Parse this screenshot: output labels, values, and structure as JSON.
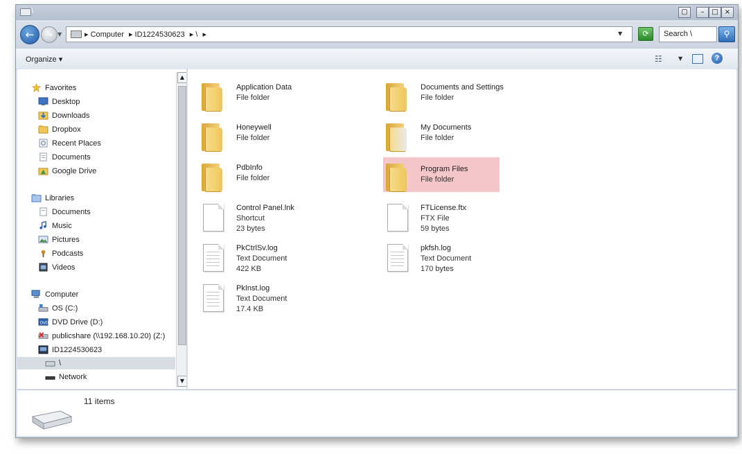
{
  "window": {
    "title": "\\"
  },
  "address": {
    "crumbs": [
      "▸ Computer",
      "▸ ID1224530623",
      "▸ \\",
      "▸"
    ],
    "search_placeholder": "Search \\"
  },
  "toolbar": {
    "organize_label": "Organize ▾"
  },
  "nav": {
    "favorites_header": "Favorites",
    "favorites": [
      "Desktop",
      "Downloads",
      "Dropbox",
      "Recent Places",
      "Documents",
      "Google Drive"
    ],
    "libraries_header": "Libraries",
    "libraries": [
      "Documents",
      "Music",
      "Pictures",
      "Podcasts",
      "Videos"
    ],
    "computer_header": "Computer",
    "computer": [
      "OS (C:)",
      "DVD Drive (D:)",
      "publicshare (\\\\192.168.10.20) (Z:)",
      "ID1224530623",
      "\\"
    ],
    "network_label": "Network"
  },
  "files": [
    {
      "name": "Application Data",
      "line1": "File folder",
      "line2": "",
      "icon": "folder-icon"
    },
    {
      "name": "Documents and Settings",
      "line1": "File folder",
      "line2": "",
      "icon": "folder-icon"
    },
    {
      "name": "Honeywell",
      "line1": "File folder",
      "line2": "",
      "icon": "folder-icon"
    },
    {
      "name": "My Documents",
      "line1": "File folder",
      "line2": "",
      "icon": "folder-icon"
    },
    {
      "name": "PdbInfo",
      "line1": "File folder",
      "line2": "",
      "icon": "folder-icon"
    },
    {
      "name": "Program Files",
      "line1": "File folder",
      "line2": "",
      "icon": "folder-icon",
      "highlighted": true
    },
    {
      "name": "Control Panel.lnk",
      "line1": "Shortcut",
      "line2": "23 bytes",
      "icon": "blank-file-icon"
    },
    {
      "name": "FTLicense.ftx",
      "line1": "FTX File",
      "line2": "59 bytes",
      "icon": "blank-file-icon"
    },
    {
      "name": "PkCtrlSv.log",
      "line1": "Text Document",
      "line2": "422 KB",
      "icon": "text-file-icon"
    },
    {
      "name": "pkfsh.log",
      "line1": "Text Document",
      "line2": "170 bytes",
      "icon": "text-file-icon"
    },
    {
      "name": "PkInst.log",
      "line1": "Text Document",
      "line2": "17.4 KB",
      "icon": "text-file-icon"
    }
  ],
  "details": {
    "item_count": "11 items"
  },
  "colors": {
    "highlight": "#f5c6c8",
    "selection": "#d8dde3",
    "chrome": "#dce3ec"
  }
}
